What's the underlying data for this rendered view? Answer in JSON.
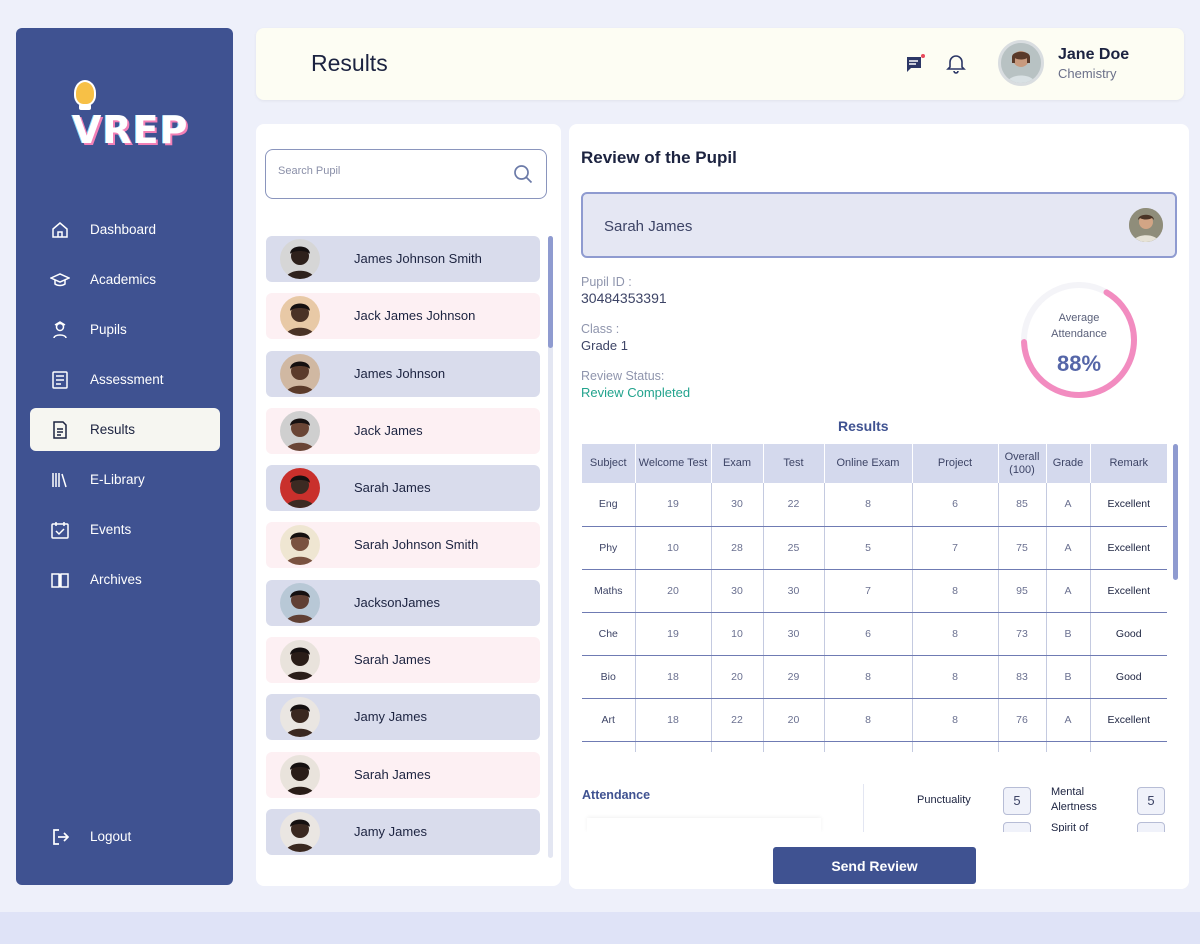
{
  "brand": {
    "logo_text": "VREP"
  },
  "sidebar": {
    "items": [
      {
        "label": "Dashboard",
        "icon": "home-icon",
        "active": false
      },
      {
        "label": "Academics",
        "icon": "graduation-cap-icon",
        "active": false
      },
      {
        "label": "Pupils",
        "icon": "pupil-icon",
        "active": false
      },
      {
        "label": "Assessment",
        "icon": "assessment-icon",
        "active": false
      },
      {
        "label": "Results",
        "icon": "results-icon",
        "active": true
      },
      {
        "label": "E-Library",
        "icon": "library-icon",
        "active": false
      },
      {
        "label": "Events",
        "icon": "calendar-icon",
        "active": false
      },
      {
        "label": "Archives",
        "icon": "book-open-icon",
        "active": false
      }
    ],
    "logout_label": "Logout"
  },
  "header": {
    "title": "Results",
    "user": {
      "name": "Jane Doe",
      "subject": "Chemistry"
    }
  },
  "search": {
    "placeholder": "Search Pupil",
    "value": ""
  },
  "pupils": [
    {
      "name": "James Johnson Smith",
      "style": "blue"
    },
    {
      "name": "Jack James Johnson",
      "style": "pink"
    },
    {
      "name": "James Johnson",
      "style": "blue"
    },
    {
      "name": "Jack James",
      "style": "pink"
    },
    {
      "name": "Sarah James",
      "style": "blue"
    },
    {
      "name": "Sarah Johnson Smith",
      "style": "pink"
    },
    {
      "name": "JacksonJames",
      "style": "blue"
    },
    {
      "name": "Sarah James",
      "style": "pink"
    },
    {
      "name": "Jamy James",
      "style": "blue"
    },
    {
      "name": "Sarah James",
      "style": "pink"
    },
    {
      "name": "Jamy James",
      "style": "blue"
    }
  ],
  "review": {
    "title": "Review of the Pupil",
    "selected_pupil": "Sarah James",
    "pupil_id_label": "Pupil ID :",
    "pupil_id": "30484353391",
    "class_label": "Class :",
    "class_value": "Grade 1",
    "status_label": "Review Status:",
    "status_value": "Review Completed",
    "attendance_gauge": {
      "label_line1": "Average",
      "label_line2": "Attendance",
      "value_text": "88%",
      "value": 0.88
    },
    "results_title": "Results",
    "table": {
      "headers": [
        "Subject",
        "Welcome Test",
        "Exam",
        "Test",
        "Online Exam",
        "Project",
        "Overall (100)",
        "Grade",
        "Remark"
      ],
      "rows": [
        [
          "Eng",
          "19",
          "30",
          "22",
          "8",
          "6",
          "85",
          "A",
          "Excellent"
        ],
        [
          "Phy",
          "10",
          "28",
          "25",
          "5",
          "7",
          "75",
          "A",
          "Excellent"
        ],
        [
          "Maths",
          "20",
          "30",
          "30",
          "7",
          "8",
          "95",
          "A",
          "Excellent"
        ],
        [
          "Che",
          "19",
          "10",
          "30",
          "6",
          "8",
          "73",
          "B",
          "Good"
        ],
        [
          "Bio",
          "18",
          "20",
          "29",
          "8",
          "8",
          "83",
          "B",
          "Good"
        ],
        [
          "Art",
          "18",
          "22",
          "20",
          "8",
          "8",
          "76",
          "A",
          "Excellent"
        ],
        [
          "",
          "",
          "",
          "",
          "",
          "",
          "",
          "",
          ""
        ]
      ]
    },
    "attendance_label": "Attendance",
    "ratings": [
      {
        "label": "Punctuality",
        "value": "5"
      },
      {
        "label": "Mental Alertness",
        "value": "5"
      },
      {
        "label": "",
        "value": ""
      },
      {
        "label": "Spirit of",
        "value": ""
      }
    ],
    "send_label": "Send Review"
  },
  "colors": {
    "sidebar": "#3f5291",
    "accent": "#3f5291",
    "gauge": "#f28cc0",
    "status_green": "#22a38d"
  }
}
